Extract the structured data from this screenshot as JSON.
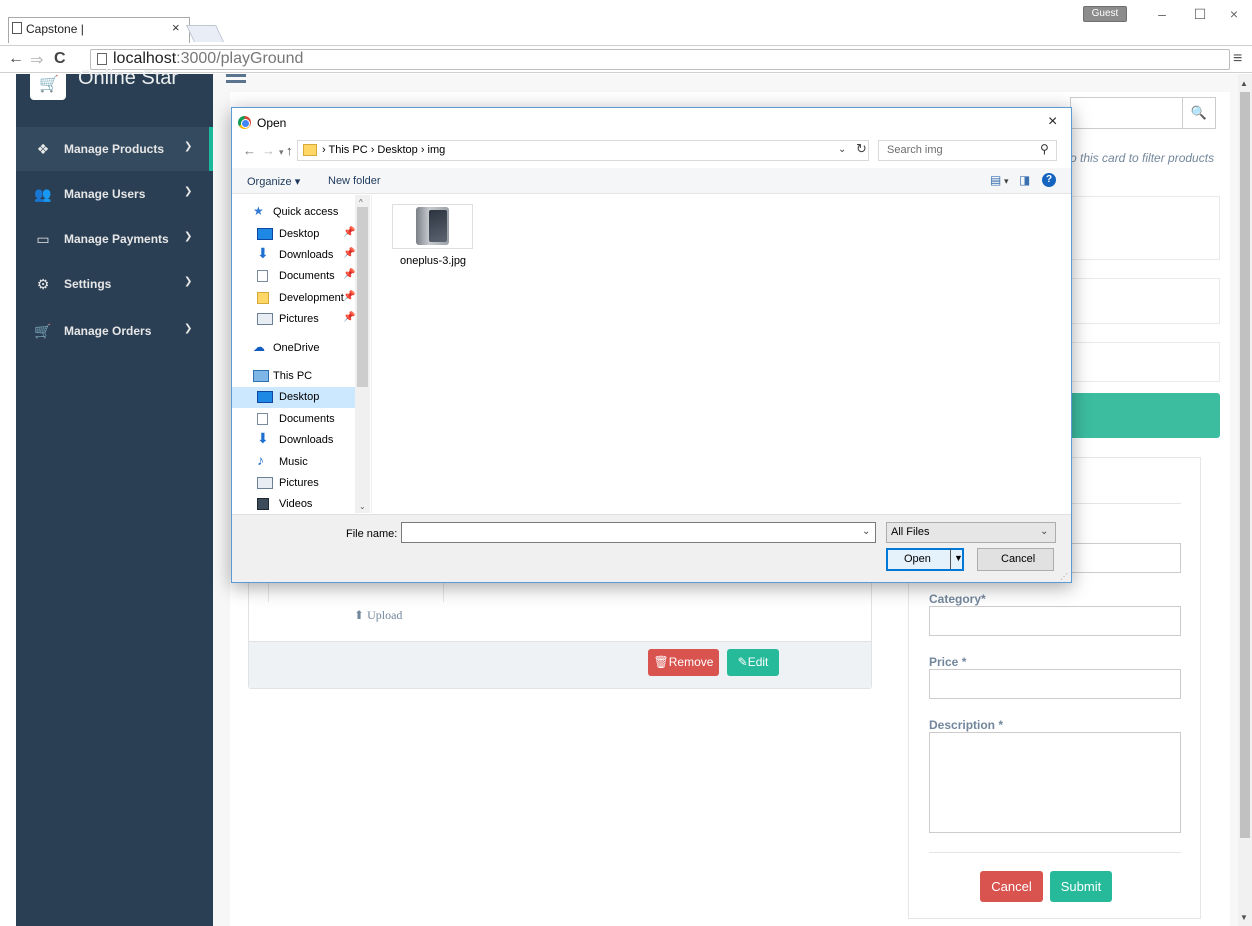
{
  "browser": {
    "tab_title": "Capstone |",
    "tab_close": "×",
    "profile": "Guest",
    "win_minimize": "–",
    "win_maximize": "☐",
    "win_close": "×",
    "url_host": "localhost",
    "url_path": ":3000/playGround"
  },
  "app": {
    "brand": "Online Star",
    "sidebar": [
      {
        "label": "Manage Products",
        "icon": "cubes-icon",
        "active": true
      },
      {
        "label": "Manage Users",
        "icon": "users-icon"
      },
      {
        "label": "Manage Payments",
        "icon": "credit-card-icon"
      },
      {
        "label": "Settings",
        "icon": "cogs-icon"
      },
      {
        "label": "Manage Orders",
        "icon": "shopping-cart-icon"
      }
    ],
    "filter_hint": "o this card to filter products",
    "upload_label": "Upload",
    "remove_label": "Remove",
    "edit_label": "Edit",
    "form": {
      "category_label": "Category*",
      "price_label": "Price *",
      "description_label": "Description *",
      "cancel_label": "Cancel",
      "submit_label": "Submit"
    },
    "colors": {
      "sidebar": "#2a3f54",
      "accent": "#26b99a",
      "danger": "#d9534f"
    }
  },
  "dialog": {
    "title": "Open",
    "close": "×",
    "breadcrumb": "›  This PC  ›  Desktop  ›  img",
    "search_placeholder": "Search img",
    "organize": "Organize ▾",
    "new_folder": "New folder",
    "help": "?",
    "nav": [
      {
        "label": "Quick access",
        "icon": "star-icon",
        "level": 0
      },
      {
        "label": "Desktop",
        "icon": "desktop-folder-icon",
        "level": 1,
        "pinned": true
      },
      {
        "label": "Downloads",
        "icon": "download-folder-icon",
        "level": 1,
        "pinned": true
      },
      {
        "label": "Documents",
        "icon": "documents-folder-icon",
        "level": 1,
        "pinned": true
      },
      {
        "label": "Development",
        "icon": "folder-icon",
        "level": 1,
        "pinned": true
      },
      {
        "label": "Pictures",
        "icon": "pictures-folder-icon",
        "level": 1,
        "pinned": true
      },
      {
        "label": "OneDrive",
        "icon": "cloud-icon",
        "level": 0
      },
      {
        "label": "This PC",
        "icon": "computer-icon",
        "level": 0
      },
      {
        "label": "Desktop",
        "icon": "desktop-folder-icon",
        "level": 1,
        "selected": true
      },
      {
        "label": "Documents",
        "icon": "documents-folder-icon",
        "level": 1
      },
      {
        "label": "Downloads",
        "icon": "download-folder-icon",
        "level": 1
      },
      {
        "label": "Music",
        "icon": "music-folder-icon",
        "level": 1
      },
      {
        "label": "Pictures",
        "icon": "pictures-folder-icon",
        "level": 1
      },
      {
        "label": "Videos",
        "icon": "videos-folder-icon",
        "level": 1
      }
    ],
    "files": [
      {
        "name": "oneplus-3.jpg"
      }
    ],
    "file_name_label": "File name:",
    "file_name_value": "",
    "filter_selected": "All Files",
    "open_label": "Open",
    "cancel_label": "Cancel"
  }
}
